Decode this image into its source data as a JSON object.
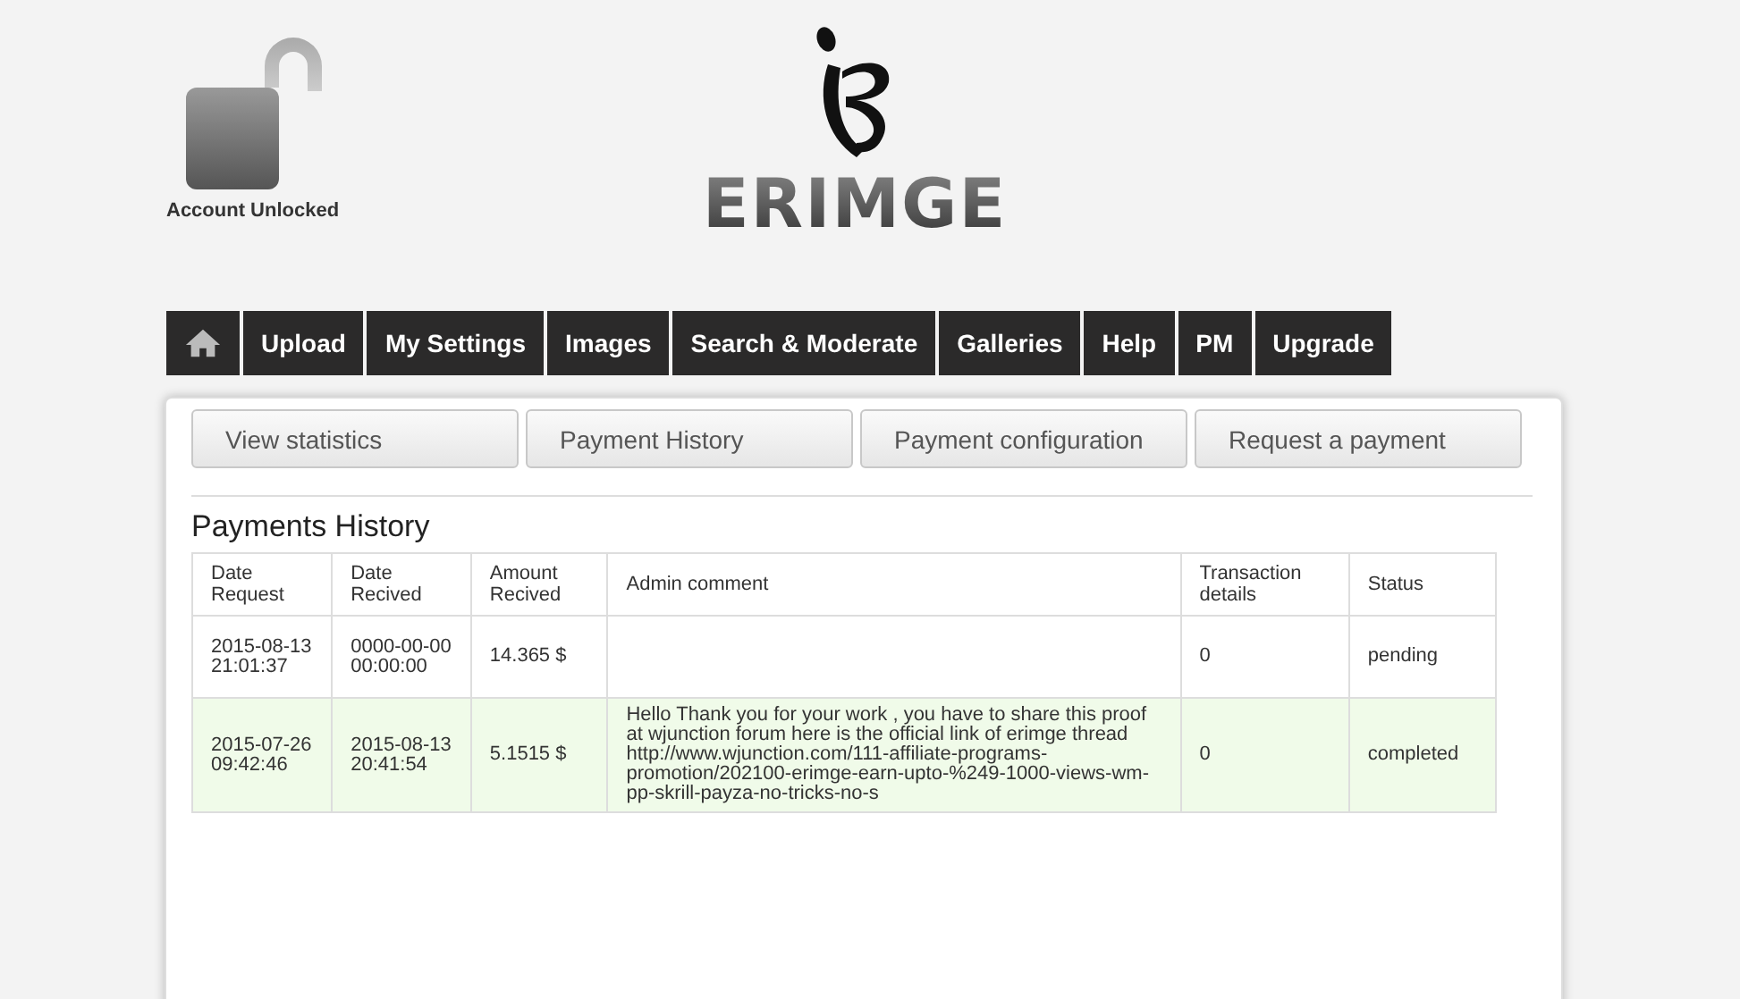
{
  "account": {
    "label": "Account Unlocked"
  },
  "logo": {
    "text": "ERIMGE"
  },
  "nav": [
    {
      "kind": "home"
    },
    {
      "kind": "text",
      "label": "Upload"
    },
    {
      "kind": "text",
      "label": "My Settings"
    },
    {
      "kind": "text",
      "label": "Images"
    },
    {
      "kind": "text",
      "label": "Search & Moderate"
    },
    {
      "kind": "text",
      "label": "Galleries"
    },
    {
      "kind": "text",
      "label": "Help"
    },
    {
      "kind": "text",
      "label": "PM"
    },
    {
      "kind": "text",
      "label": "Upgrade"
    }
  ],
  "tabs": [
    "View statistics",
    "Payment History",
    "Payment configuration",
    "Request a payment"
  ],
  "section_title": "Payments History",
  "table": {
    "columns": [
      "Date Request",
      "Date Recived",
      "Amount Recived",
      "Admin comment",
      "Transaction details",
      "Status"
    ],
    "rows": [
      {
        "highlighted": false,
        "cells": [
          "2015-08-13 21:01:37",
          "0000-00-00 00:00:00",
          "14.365 $",
          "",
          "0",
          "pending"
        ]
      },
      {
        "highlighted": true,
        "cells": [
          "2015-07-26 09:42:46",
          "2015-08-13 20:41:54",
          "5.1515 $",
          "Hello Thank you for your work , you have to share this proof at wjunction forum here is the official link of erimge thread http://www.wjunction.com/111-affiliate-programs-promotion/202100-erimge-earn-upto-%249-1000-views-wm-pp-skrill-payza-no-tricks-no-s",
          "0",
          "completed"
        ]
      }
    ]
  }
}
